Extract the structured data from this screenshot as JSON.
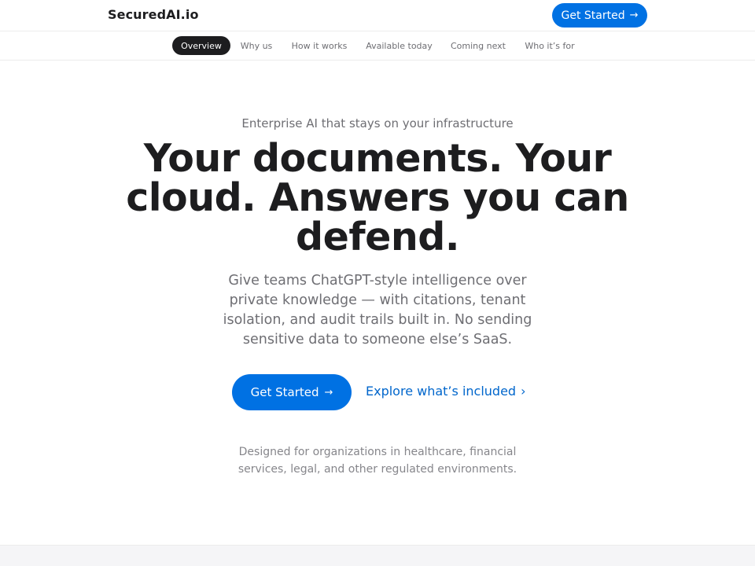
{
  "header": {
    "brand": "SecuredAI.io",
    "cta_label": "Get Started",
    "cta_icon": "arrow-right-icon"
  },
  "subnav": {
    "tabs": [
      {
        "label": "Overview",
        "active": true
      },
      {
        "label": "Why us",
        "active": false
      },
      {
        "label": "How it works",
        "active": false
      },
      {
        "label": "Available today",
        "active": false
      },
      {
        "label": "Coming next",
        "active": false
      },
      {
        "label": "Who it’s for",
        "active": false
      }
    ]
  },
  "hero": {
    "eyebrow": "Enterprise AI that stays on your infrastructure",
    "headline": "Your documents. Your cloud. Answers you can defend.",
    "lede": "Give teams ChatGPT-style intelligence over private knowledge — with citations, tenant isolation, and audit trails built in. No sending sensitive data to someone else’s SaaS.",
    "cta_label": "Get Started",
    "cta_icon": "arrow-right-icon",
    "link_label": "Explore what’s included",
    "link_icon": "chevron-right-icon",
    "footnote": "Designed for organizations in healthcare, financial services, legal, and other regulated environments."
  },
  "colors": {
    "accent": "#0071e3",
    "link": "#0066cc",
    "text": "#1d1d1f",
    "muted": "#6e6e73",
    "active_tab_bg": "#1d1d1f"
  }
}
